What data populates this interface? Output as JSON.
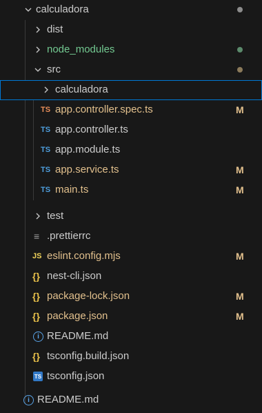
{
  "explorer": {
    "items": [
      {
        "label": "calculadora",
        "type": "folder",
        "expanded": true,
        "status": "dot"
      },
      {
        "label": "dist",
        "type": "folder",
        "expanded": false
      },
      {
        "label": "node_modules",
        "type": "folder",
        "expanded": false,
        "status": "dot"
      },
      {
        "label": "src",
        "type": "folder",
        "expanded": true,
        "status": "dot"
      },
      {
        "label": "calculadora",
        "type": "folder",
        "expanded": false,
        "selected": true
      },
      {
        "label": "app.controller.spec.ts",
        "type": "ts",
        "badge": "M"
      },
      {
        "label": "app.controller.ts",
        "type": "ts"
      },
      {
        "label": "app.module.ts",
        "type": "ts"
      },
      {
        "label": "app.service.ts",
        "type": "ts",
        "badge": "M"
      },
      {
        "label": "main.ts",
        "type": "ts",
        "badge": "M"
      },
      {
        "label": "test",
        "type": "folder",
        "expanded": false
      },
      {
        "label": ".prettierrc",
        "type": "config"
      },
      {
        "label": "eslint.config.mjs",
        "type": "js",
        "badge": "M"
      },
      {
        "label": "nest-cli.json",
        "type": "json"
      },
      {
        "label": "package-lock.json",
        "type": "json",
        "badge": "M"
      },
      {
        "label": "package.json",
        "type": "json",
        "badge": "M"
      },
      {
        "label": "README.md",
        "type": "info"
      },
      {
        "label": "tsconfig.build.json",
        "type": "json"
      },
      {
        "label": "tsconfig.json",
        "type": "tsconfig"
      },
      {
        "label": "README.md",
        "type": "info"
      }
    ]
  },
  "icons": {
    "ts": "TS",
    "js": "JS",
    "json": "{}",
    "info": "i",
    "config": "≡",
    "tsconfig": "TS"
  },
  "colors": {
    "background": "#181818",
    "modified": "#e2c08d",
    "untracked": "#73c991",
    "selection_border": "#0078d4",
    "ts_icon": "#4e9fde",
    "ts_icon_modified": "#e88e5a",
    "js_icon": "#f1d35a",
    "json_icon": "#e8c04a"
  }
}
